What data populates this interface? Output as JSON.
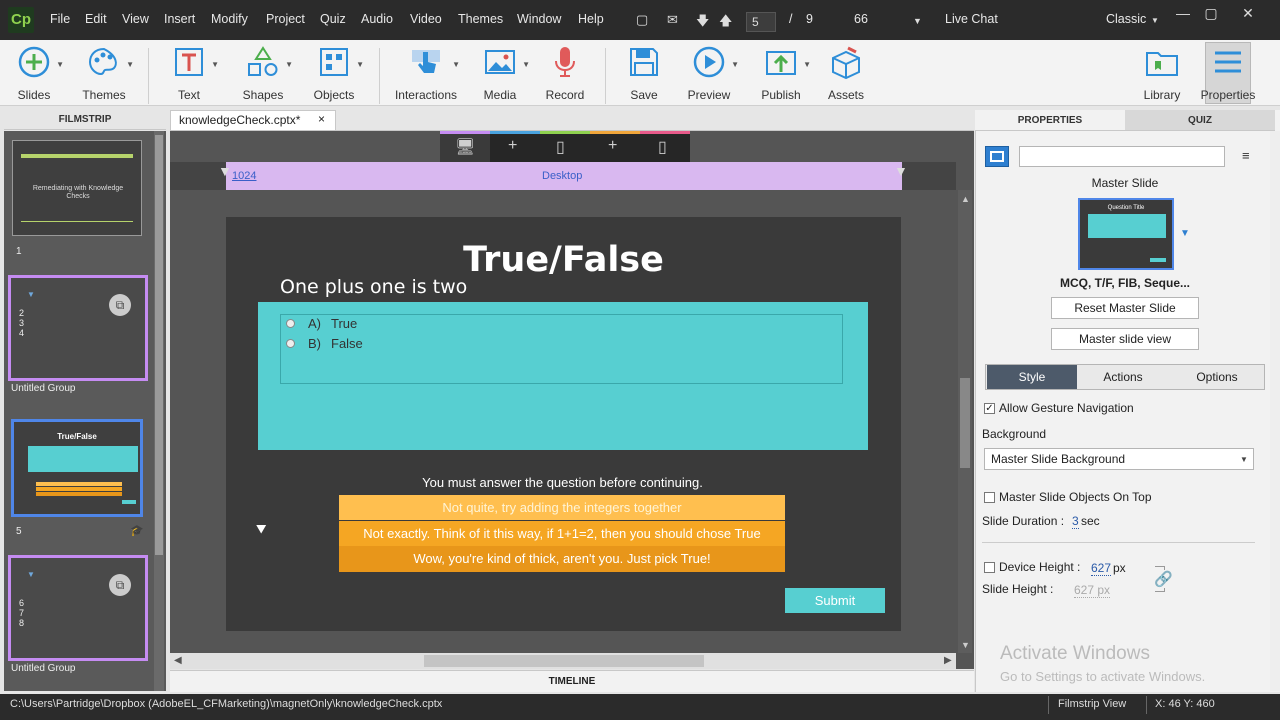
{
  "menubar": {
    "logo": "Cp",
    "items": [
      "File",
      "Edit",
      "View",
      "Insert",
      "Modify",
      "Project",
      "Quiz",
      "Audio",
      "Video",
      "Themes",
      "Window",
      "Help"
    ],
    "current_slide": "5",
    "slide_sep": "/",
    "total_slides": "9",
    "zoom": "66",
    "live_chat": "Live Chat",
    "workspace": "Classic"
  },
  "toolbar": {
    "slides": "Slides",
    "themes": "Themes",
    "text": "Text",
    "shapes": "Shapes",
    "objects": "Objects",
    "interactions": "Interactions",
    "media": "Media",
    "record": "Record",
    "save": "Save",
    "preview": "Preview",
    "publish": "Publish",
    "assets": "Assets",
    "library": "Library",
    "properties": "Properties"
  },
  "filmstrip": {
    "header": "FILMSTRIP",
    "slide1_title": "Remediating with Knowledge Checks",
    "slide1_num": "1",
    "group1_nums": [
      "2",
      "3",
      "4"
    ],
    "group1_label": "Untitled Group",
    "slide5_title": "True/False",
    "slide5_num": "5",
    "group2_nums": [
      "6",
      "7",
      "8"
    ],
    "group2_label": "Untitled Group"
  },
  "doc": {
    "tab_label": "knowledgeCheck.cptx*",
    "close": "×"
  },
  "stage": {
    "breakpoint_width": "1024",
    "breakpoint_name": "Desktop",
    "question_title": "True/False",
    "question_text": "One plus one is two",
    "options": [
      {
        "letter": "A)",
        "text": "True"
      },
      {
        "letter": "B)",
        "text": "False"
      }
    ],
    "must_answer": "You must answer the question before continuing.",
    "feedback": [
      "Not quite, try adding the integers together",
      "Not exactly. Think of it this way, if 1+1=2, then you should chose True",
      "Wow, you're kind of thick, aren't you. Just pick True!"
    ],
    "submit": "Submit"
  },
  "timeline": {
    "label": "TIMELINE"
  },
  "properties": {
    "tab_properties": "PROPERTIES",
    "tab_quiz": "QUIZ",
    "name_value": "",
    "master_slide_label": "Master Slide",
    "master_thumb_title": "Question Title",
    "master_name": "MCQ, T/F, FIB, Seque...",
    "reset_btn": "Reset Master Slide",
    "view_btn": "Master slide view",
    "seg_style": "Style",
    "seg_actions": "Actions",
    "seg_options": "Options",
    "allow_gesture": "Allow Gesture Navigation",
    "background_label": "Background",
    "background_value": "Master Slide Background",
    "master_objects_top": "Master Slide Objects On Top",
    "slide_duration_label": "Slide Duration :",
    "slide_duration_value": "3",
    "slide_duration_unit": "sec",
    "device_height_label": "Device Height :",
    "device_height_value": "627",
    "device_height_unit": "px",
    "slide_height_label": "Slide Height :",
    "slide_height_value": "627 px"
  },
  "statusbar": {
    "path": "C:\\Users\\Partridge\\Dropbox (AdobeEL_CFMarketing)\\magnetOnly\\knowledgeCheck.cptx",
    "view": "Filmstrip View",
    "coords": "X: 46 Y: 460"
  },
  "watermark": {
    "line1": "Activate Windows",
    "line2": "Go to Settings to activate Windows."
  },
  "colors": {
    "accent_teal": "#57cfd1",
    "feedback1": "#ffbf4f",
    "feedback2": "#f5a623",
    "feedback3": "#e8961a",
    "breakpoint": "#d9b8f0"
  }
}
